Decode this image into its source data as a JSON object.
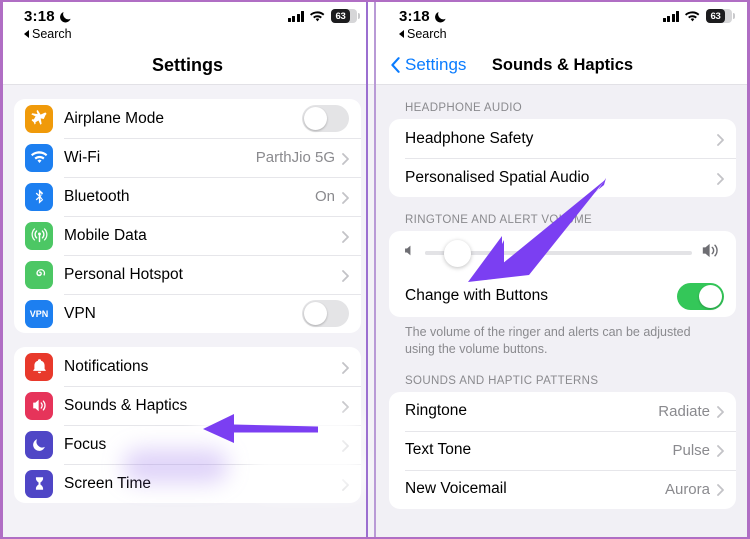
{
  "theme": {
    "accent_blue": "#0a7cff",
    "toggle_on_green": "#34c759",
    "arrow_purple": "#7b3ff2",
    "frame_purple": "#b06ec4",
    "group_bg": "#ffffff",
    "page_bg": "#f2f1f6",
    "secondary_text": "#8a8a8e"
  },
  "status_bar": {
    "time": "3:18",
    "moon_icon": "crescent-moon-icon",
    "back_label": "Search",
    "back_icon": "back-triangle-icon",
    "signal_icon": "cellular-signal-icon",
    "wifi_icon": "wifi-icon",
    "battery_icon": "battery-icon",
    "battery_percent": "63"
  },
  "left_panel": {
    "nav": {
      "title": "Settings"
    },
    "groups": [
      {
        "rows": [
          {
            "label": "Airplane Mode",
            "icon": "airplane-icon",
            "icon_color": "#f09a0a",
            "accessory": "toggle",
            "toggle_state": "off"
          },
          {
            "label": "Wi-Fi",
            "icon": "wifi-icon",
            "icon_color": "#1d7ff0",
            "accessory": "value",
            "value": "ParthJio 5G"
          },
          {
            "label": "Bluetooth",
            "icon": "bluetooth-icon",
            "icon_color": "#1d7ff0",
            "accessory": "value",
            "value": "On"
          },
          {
            "label": "Mobile Data",
            "icon": "cellular-antenna-icon",
            "icon_color": "#4cc764",
            "accessory": "chevron",
            "value": ""
          },
          {
            "label": "Personal Hotspot",
            "icon": "hotspot-icon",
            "icon_color": "#4cc764",
            "accessory": "chevron",
            "value": ""
          },
          {
            "label": "VPN",
            "icon": "vpn-icon",
            "icon_color": "#1d7ff0",
            "accessory": "toggle",
            "toggle_state": "off"
          }
        ]
      },
      {
        "rows": [
          {
            "label": "Notifications",
            "icon": "notification-bell-icon",
            "icon_color": "#e8392b",
            "accessory": "chevron",
            "value": ""
          },
          {
            "label": "Sounds & Haptics",
            "icon": "speaker-icon",
            "icon_color": "#e6345a",
            "accessory": "chevron",
            "value": ""
          },
          {
            "label": "Focus",
            "icon": "moon-focus-icon",
            "icon_color": "#4f46c6",
            "accessory": "chevron",
            "value": ""
          },
          {
            "label": "Screen Time",
            "icon": "hourglass-icon",
            "icon_color": "#4f46c6",
            "accessory": "chevron",
            "value": ""
          }
        ]
      }
    ],
    "annotation": {
      "arrow": "left-pointing-arrow",
      "target": "Sounds & Haptics"
    }
  },
  "right_panel": {
    "nav": {
      "back_label": "Settings",
      "back_icon": "chevron-left-icon",
      "title": "Sounds & Haptics"
    },
    "sections": [
      {
        "header": "HEADPHONE AUDIO",
        "rows": [
          {
            "label": "Headphone Safety",
            "accessory": "chevron",
            "value": ""
          },
          {
            "label": "Personalised Spatial Audio",
            "accessory": "chevron",
            "value": ""
          }
        ],
        "footer": ""
      },
      {
        "header": "RINGTONE AND ALERT VOLUME",
        "slider": {
          "value_percent": 12,
          "min_icon": "speaker-low-icon",
          "max_icon": "speaker-high-icon"
        },
        "rows": [
          {
            "label": "Change with Buttons",
            "accessory": "toggle",
            "toggle_state": "on",
            "value": ""
          }
        ],
        "footer": "The volume of the ringer and alerts can be adjusted using the volume buttons."
      },
      {
        "header": "SOUNDS AND HAPTIC PATTERNS",
        "rows": [
          {
            "label": "Ringtone",
            "accessory": "value",
            "value": "Radiate"
          },
          {
            "label": "Text Tone",
            "accessory": "value",
            "value": "Pulse"
          },
          {
            "label": "New Voicemail",
            "accessory": "value",
            "value": "Aurora"
          }
        ],
        "footer": ""
      }
    ],
    "annotation": {
      "arrow": "down-left-pointing-arrow",
      "target": "Ringtone and alert volume slider"
    }
  }
}
